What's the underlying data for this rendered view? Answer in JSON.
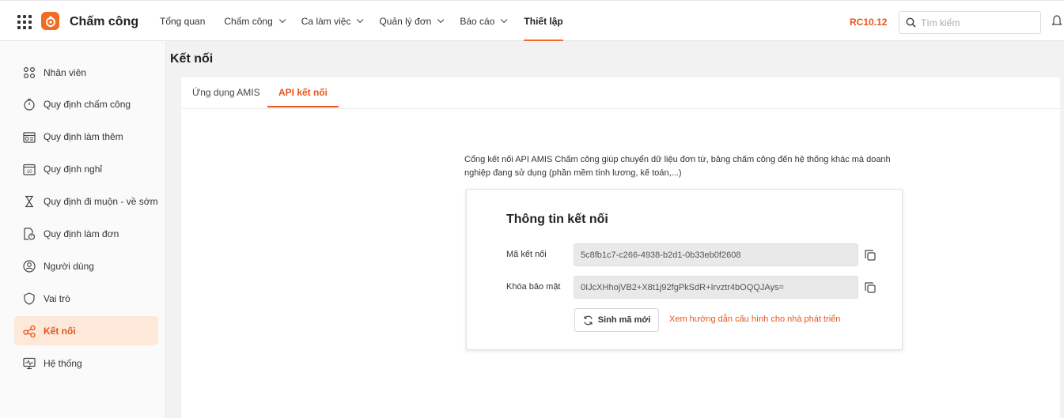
{
  "app": {
    "brand": "Chấm công",
    "version": "RC10.12"
  },
  "nav": [
    {
      "label": "Tổng quan",
      "dropdown": false
    },
    {
      "label": "Chấm công",
      "dropdown": true
    },
    {
      "label": "Ca làm việc",
      "dropdown": true
    },
    {
      "label": "Quản lý đơn",
      "dropdown": true
    },
    {
      "label": "Báo cáo",
      "dropdown": true
    },
    {
      "label": "Thiết lập",
      "dropdown": false,
      "active": true
    }
  ],
  "search": {
    "placeholder": "Tìm kiếm"
  },
  "sidebar": {
    "items": [
      {
        "label": "Nhân viên",
        "icon": "people-icon"
      },
      {
        "label": "Quy định chấm công",
        "icon": "stopwatch-icon"
      },
      {
        "label": "Quy định làm thêm",
        "icon": "overtime-icon"
      },
      {
        "label": "Quy định nghỉ",
        "icon": "calendar-icon"
      },
      {
        "label": "Quy định đi muộn - về sớm",
        "icon": "hourglass-icon"
      },
      {
        "label": "Quy định làm đơn",
        "icon": "document-icon"
      },
      {
        "label": "Người dùng",
        "icon": "user-circle-icon"
      },
      {
        "label": "Vai trò",
        "icon": "shield-icon"
      },
      {
        "label": "Kết nối",
        "icon": "share-icon",
        "active": true
      },
      {
        "label": "Hệ thống",
        "icon": "monitor-icon"
      }
    ]
  },
  "main": {
    "title": "Kết nối",
    "tabs": [
      {
        "label": "Ứng dụng AMIS"
      },
      {
        "label": "API kết nối",
        "active": true
      }
    ],
    "description": "Cổng kết nối API AMIS Chấm công giúp chuyển dữ liệu đơn từ, bảng chấm công đến hệ thống khác mà doanh nghiệp đang sử dụng (phần mềm tính lương, kế toán,...)",
    "card": {
      "title": "Thông tin kết nối",
      "connection_code_label": "Mã kết nối",
      "connection_code_value": "5c8fb1c7-c266-4938-b2d1-0b33eb0f2608",
      "secret_key_label": "Khóa bảo mật",
      "secret_key_value": "0IJcXHhojVB2+X8t1j92fgPkSdR+Irvztr4bOQQJAys=",
      "generate_button": "Sinh mã mới",
      "guide_link": "Xem hướng dẫn cấu hình cho nhà phát triển"
    }
  },
  "colors": {
    "accent": "#e8541a",
    "active_bg": "#fde8d9"
  }
}
